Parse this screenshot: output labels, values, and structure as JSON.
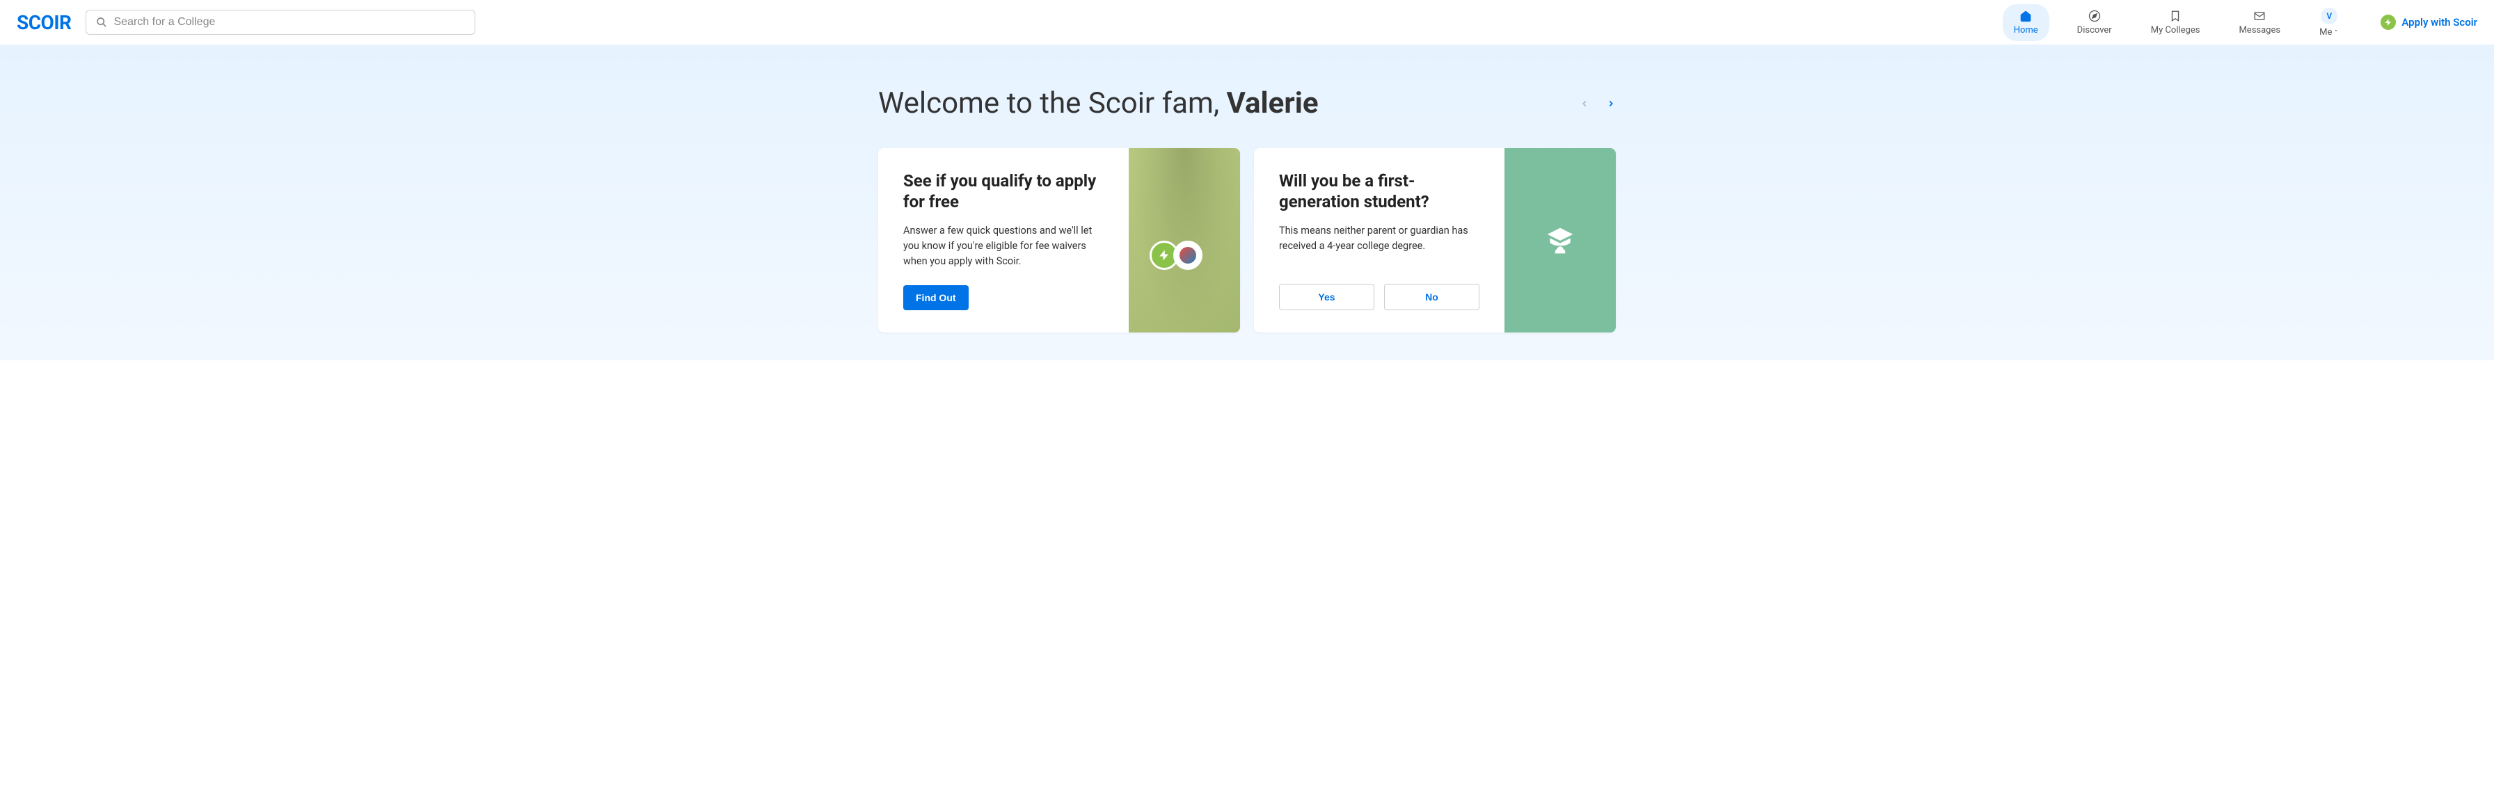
{
  "header": {
    "logo": "SCOIR",
    "search_placeholder": "Search for a College",
    "nav": [
      {
        "label": "Home",
        "icon": "home",
        "active": true
      },
      {
        "label": "Discover",
        "icon": "compass",
        "active": false
      },
      {
        "label": "My Colleges",
        "icon": "bookmark",
        "active": false
      },
      {
        "label": "Messages",
        "icon": "mail",
        "active": false
      }
    ],
    "me_label": "Me",
    "avatar_initial": "V",
    "apply_label": "Apply with Scoir"
  },
  "welcome": {
    "prefix": "Welcome to the Scoir fam, ",
    "name": "Valerie"
  },
  "cards": [
    {
      "title": "See if you qualify to apply for free",
      "desc": "Answer a few quick questions and we'll let you know if you're eligible for fee waivers when you apply with Scoir.",
      "primary_button": "Find Out"
    },
    {
      "title": "Will you be a first-generation student?",
      "desc": "This means neither parent or guardian has received a 4-year college degree.",
      "yes_button": "Yes",
      "no_button": "No"
    }
  ]
}
